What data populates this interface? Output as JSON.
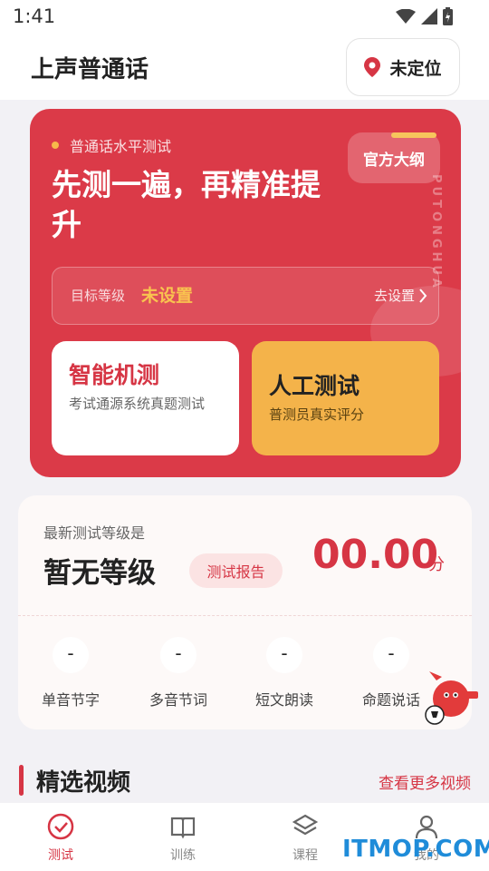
{
  "status_bar": {
    "time": "1:41"
  },
  "header": {
    "title": "上声普通话",
    "location_label": "未定位"
  },
  "hero": {
    "subtitle": "普通话水平测试",
    "title": "先测一遍，再精准提升",
    "official_button": "官方大纲",
    "vertical_text": "PUTONGHUA",
    "target_label": "目标等级",
    "target_value": "未设置",
    "target_link": "去设置",
    "smart_test": {
      "title": "智能机测",
      "desc": "考试通源系统真题测试"
    },
    "human_test": {
      "title": "人工测试",
      "desc": "普测员真实评分"
    }
  },
  "result": {
    "label": "最新测试等级是",
    "level": "暂无等级",
    "report_button": "测试报告",
    "score": "00.00",
    "score_unit": "分",
    "stats": [
      {
        "value": "-",
        "label": "单音节字"
      },
      {
        "value": "-",
        "label": "多音节词"
      },
      {
        "value": "-",
        "label": "短文朗读"
      },
      {
        "value": "-",
        "label": "命题说话"
      }
    ]
  },
  "section": {
    "title": "精选视频",
    "more": "查看更多视频"
  },
  "tabbar": {
    "tabs": [
      {
        "label": "测试",
        "icon": "check-circle-icon"
      },
      {
        "label": "训练",
        "icon": "book-icon"
      },
      {
        "label": "课程",
        "icon": "layers-icon"
      },
      {
        "label": "我的",
        "icon": "person-icon"
      }
    ]
  },
  "watermark": "ITMOP.COM",
  "colors": {
    "primary": "#db3a48",
    "accent": "#f4b34a",
    "gold": "#f9c34f"
  }
}
